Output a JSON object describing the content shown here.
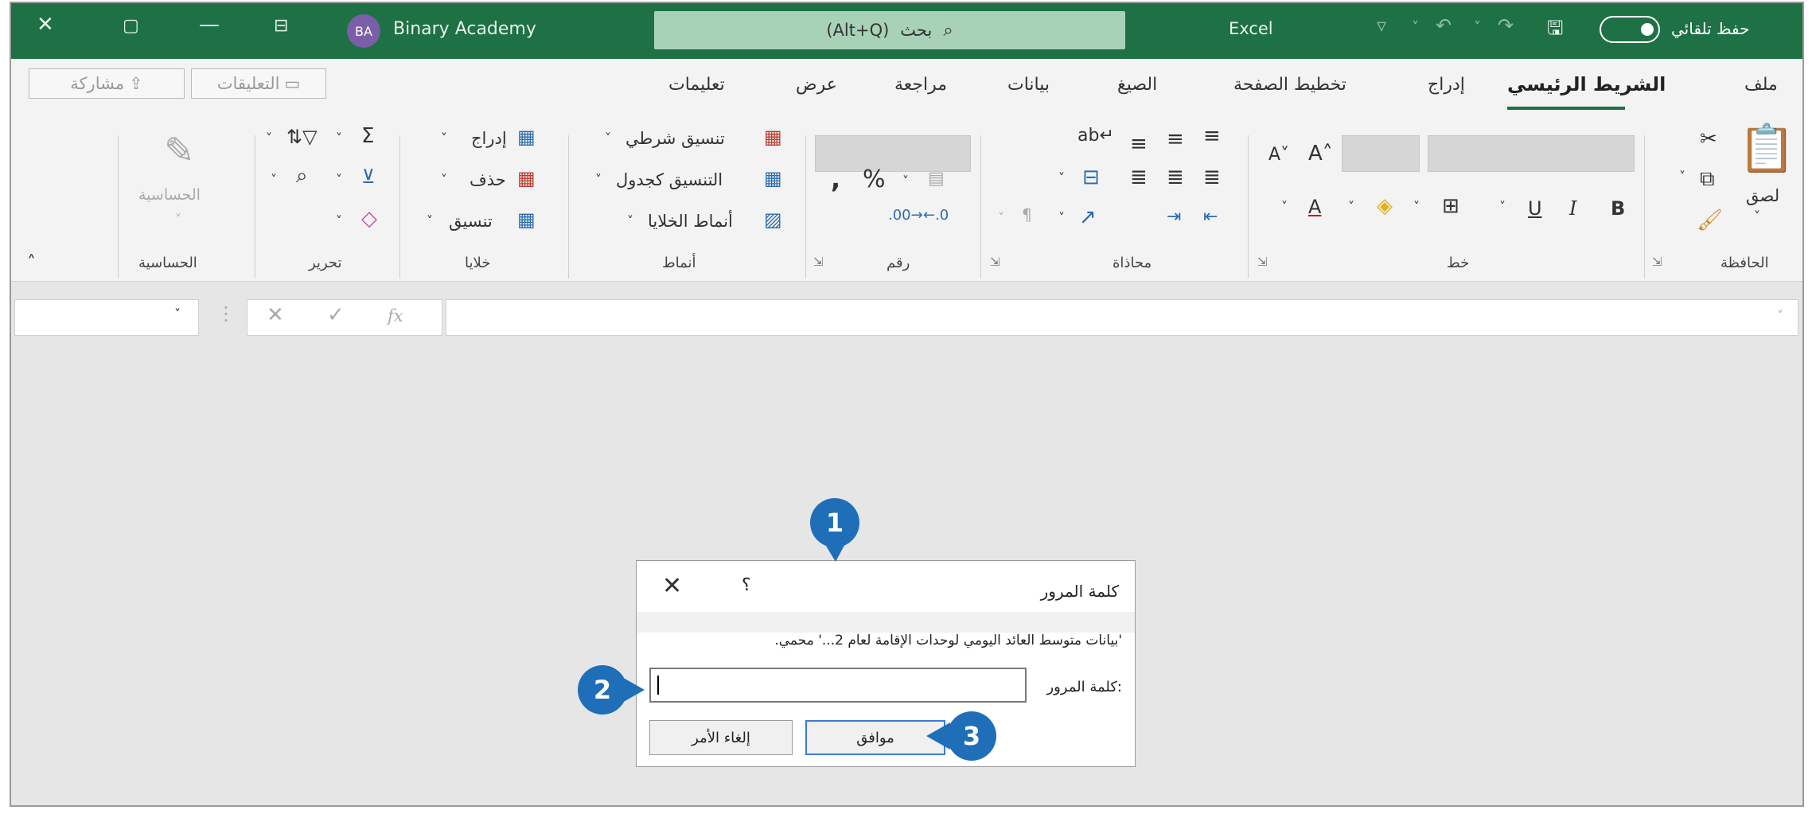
{
  "titlebar": {
    "avatar_initials": "BA",
    "user_name": "Binary Academy",
    "search_shortcut": "(Alt+Q)",
    "search_label": "بحث",
    "app_name": "Excel",
    "autosave_label": "حفظ تلقائي"
  },
  "ribbon": {
    "tabs": [
      "ملف",
      "الشريط الرئيسي",
      "إدراج",
      "تخطيط الصفحة",
      "الصيغ",
      "بيانات",
      "مراجعة",
      "عرض",
      "تعليمات"
    ],
    "active_tab": "الشريط الرئيسي",
    "share_label": "مشاركة",
    "comments_label": "التعليقات",
    "groups": {
      "clipboard": "الحافظة",
      "font": "خط",
      "alignment": "محاذاة",
      "number": "رقم",
      "styles": "أنماط",
      "cells": "خلايا",
      "editing": "تحرير",
      "sensitivity": "الحساسية"
    },
    "paste_label": "لصق",
    "styles_items": [
      "تنسيق شرطي",
      "التنسيق كجدول",
      "أنماط الخلايا"
    ],
    "cells_items": [
      "إدراج",
      "حذف",
      "تنسيق"
    ],
    "sensitivity_label": "الحساسية"
  },
  "formula_bar": {
    "fx": "fx"
  },
  "dialog": {
    "title": "كلمة المرور",
    "help": "؟",
    "message": "'بيانات متوسط العائد اليومي لوحدات الإقامة لعام 2...' محمي.",
    "password_label": "كلمة المرور:",
    "password_value": "",
    "ok_label": "موافق",
    "cancel_label": "إلغاء الأمر"
  },
  "callouts": [
    "1",
    "2",
    "3"
  ],
  "colors": {
    "titlebar": "#1e7145",
    "callout": "#1e6fb8",
    "avatar": "#7b5ea8"
  }
}
